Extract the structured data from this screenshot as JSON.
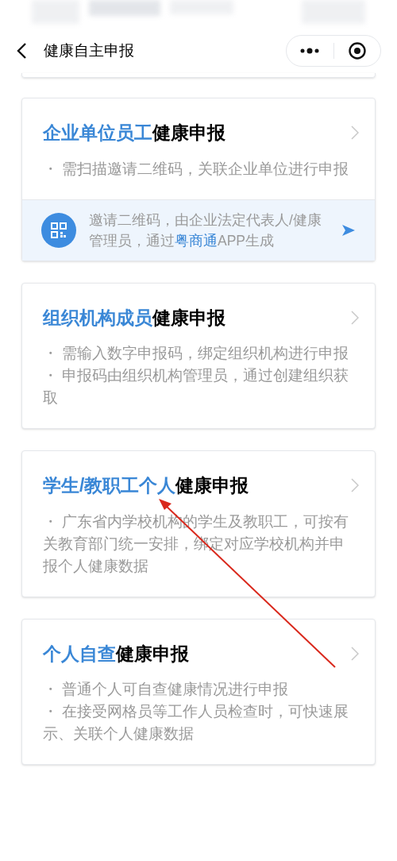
{
  "nav": {
    "title": "健康自主申报"
  },
  "cards": [
    {
      "title_accent": "企业单位员工",
      "title_rest": "健康申报",
      "bullets": [
        "・ 需扫描邀请二维码，关联企业单位进行申报"
      ],
      "banner": {
        "parts": [
          {
            "text": "邀请二维码，由企业法定代表人/健康管理员，通过",
            "highlight": false
          },
          {
            "text": "粤商通",
            "highlight": true
          },
          {
            "text": "APP生成",
            "highlight": false
          }
        ]
      }
    },
    {
      "title_accent": "组织机构成员",
      "title_rest": "健康申报",
      "bullets": [
        "・ 需输入数字申报码，绑定组织机构进行申报",
        "・ 申报码由组织机构管理员，通过创建组织获取"
      ]
    },
    {
      "title_accent": "学生/教职工个人",
      "title_rest": "健康申报",
      "bullets": [
        "・ 广东省内学校机构的学生及教职工，可按有关教育部门统一安排，绑定对应学校机构并申报个人健康数据"
      ]
    },
    {
      "title_accent": "个人自查",
      "title_rest": "健康申报",
      "bullets": [
        "・ 普通个人可自查健康情况进行申报",
        "・ 在接受网格员等工作人员检查时，可快速展示、关联个人健康数据"
      ]
    }
  ]
}
